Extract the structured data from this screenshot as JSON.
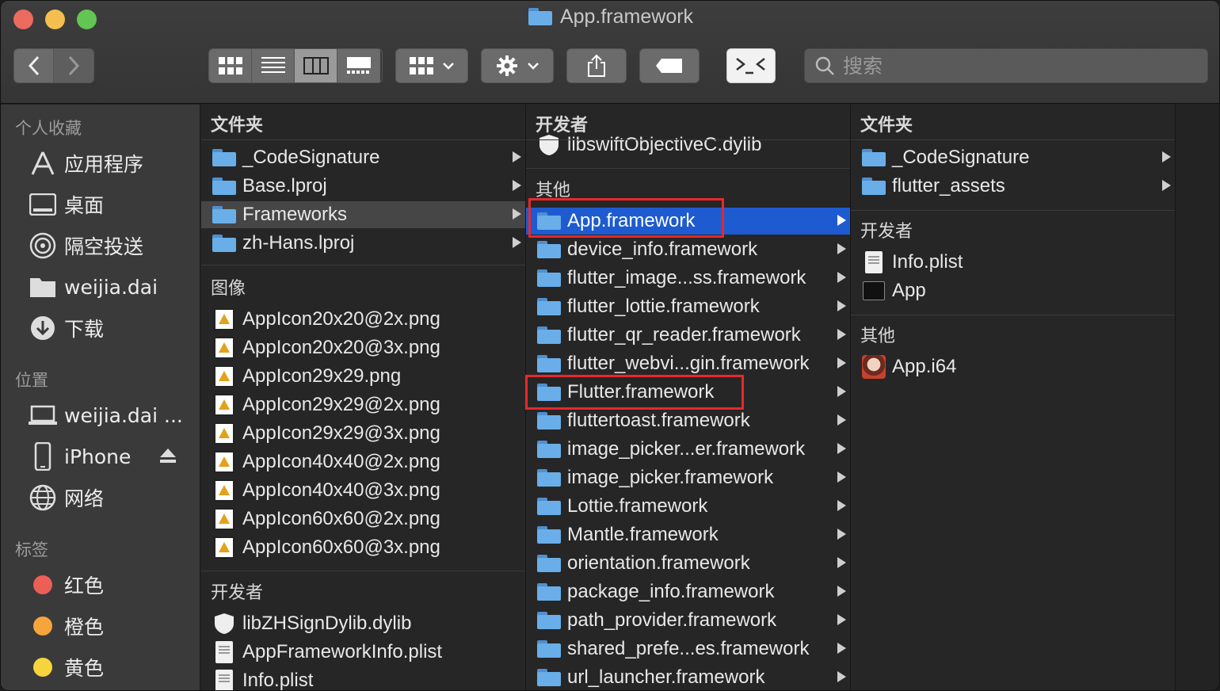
{
  "window": {
    "title": "App.framework"
  },
  "toolbar": {
    "search_placeholder": "搜索"
  },
  "sidebar": {
    "favorites_header": "个人收藏",
    "favorites": [
      {
        "label": "应用程序",
        "icon": "applications-icon"
      },
      {
        "label": "桌面",
        "icon": "desktop-icon"
      },
      {
        "label": "隔空投送",
        "icon": "airdrop-icon"
      },
      {
        "label": "weijia.dai",
        "icon": "home-folder-icon"
      },
      {
        "label": "下载",
        "icon": "downloads-icon"
      }
    ],
    "locations_header": "位置",
    "locations": [
      {
        "label": "weijia.dai ...",
        "icon": "laptop-icon"
      },
      {
        "label": "iPhone",
        "icon": "iphone-icon"
      },
      {
        "label": "网络",
        "icon": "network-icon"
      }
    ],
    "tags_header": "标签",
    "tags": [
      {
        "label": "红色",
        "color": "#ec5f56"
      },
      {
        "label": "橙色",
        "color": "#f5a53a"
      },
      {
        "label": "黄色",
        "color": "#f6d43c"
      }
    ]
  },
  "col1": {
    "folders_header": "文件夹",
    "folders": [
      "_CodeSignature",
      "Base.lproj",
      "Frameworks",
      "zh-Hans.lproj"
    ],
    "images_header": "图像",
    "images": [
      "AppIcon20x20@2x.png",
      "AppIcon20x20@3x.png",
      "AppIcon29x29.png",
      "AppIcon29x29@2x.png",
      "AppIcon29x29@3x.png",
      "AppIcon40x40@2x.png",
      "AppIcon40x40@3x.png",
      "AppIcon60x60@2x.png",
      "AppIcon60x60@3x.png"
    ],
    "dev_header": "开发者",
    "dev": [
      "libZHSignDylib.dylib",
      "AppFrameworkInfo.plist",
      "Info.plist"
    ]
  },
  "col2": {
    "dev_header": "开发者",
    "top_item": "libswiftObjectiveC.dylib",
    "other_header": "其他",
    "frameworks": [
      "App.framework",
      "device_info.framework",
      "flutter_image...ss.framework",
      "flutter_lottie.framework",
      "flutter_qr_reader.framework",
      "flutter_webvi...gin.framework",
      "Flutter.framework",
      "fluttertoast.framework",
      "image_picker...er.framework",
      "image_picker.framework",
      "Lottie.framework",
      "Mantle.framework",
      "orientation.framework",
      "package_info.framework",
      "path_provider.framework",
      "shared_prefe...es.framework",
      "url_launcher.framework"
    ]
  },
  "col3": {
    "folders_header": "文件夹",
    "folders": [
      "_CodeSignature",
      "flutter_assets"
    ],
    "dev_header": "开发者",
    "dev": [
      "Info.plist",
      "App"
    ],
    "other_header": "其他",
    "other": [
      "App.i64"
    ]
  }
}
